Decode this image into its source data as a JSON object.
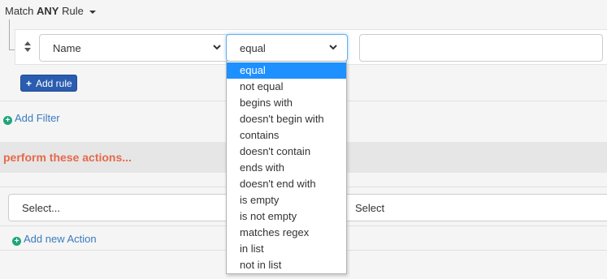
{
  "match": {
    "prefix": "Match",
    "mode": "ANY",
    "suffix": "Rule"
  },
  "rule": {
    "field_value": "Name",
    "operator_value": "equal",
    "value_input": ""
  },
  "add_rule_label": "Add rule",
  "add_filter_label": "Add Filter",
  "actions_title": "perform these actions...",
  "action": {
    "select_placeholder": "Select...",
    "select2_placeholder": "Select"
  },
  "add_action_label": "Add new Action",
  "operator_options": [
    "equal",
    "not equal",
    "begins with",
    "doesn't begin with",
    "contains",
    "doesn't contain",
    "ends with",
    "doesn't end with",
    "is empty",
    "is not empty",
    "matches regex",
    "in list",
    "not in list"
  ],
  "colors": {
    "primary_button": "#2a5db0",
    "link": "#3a7bbf",
    "accent_orange": "#e5694a",
    "add_icon_green": "#1fa67a",
    "dropdown_highlight": "#1e90ff"
  }
}
